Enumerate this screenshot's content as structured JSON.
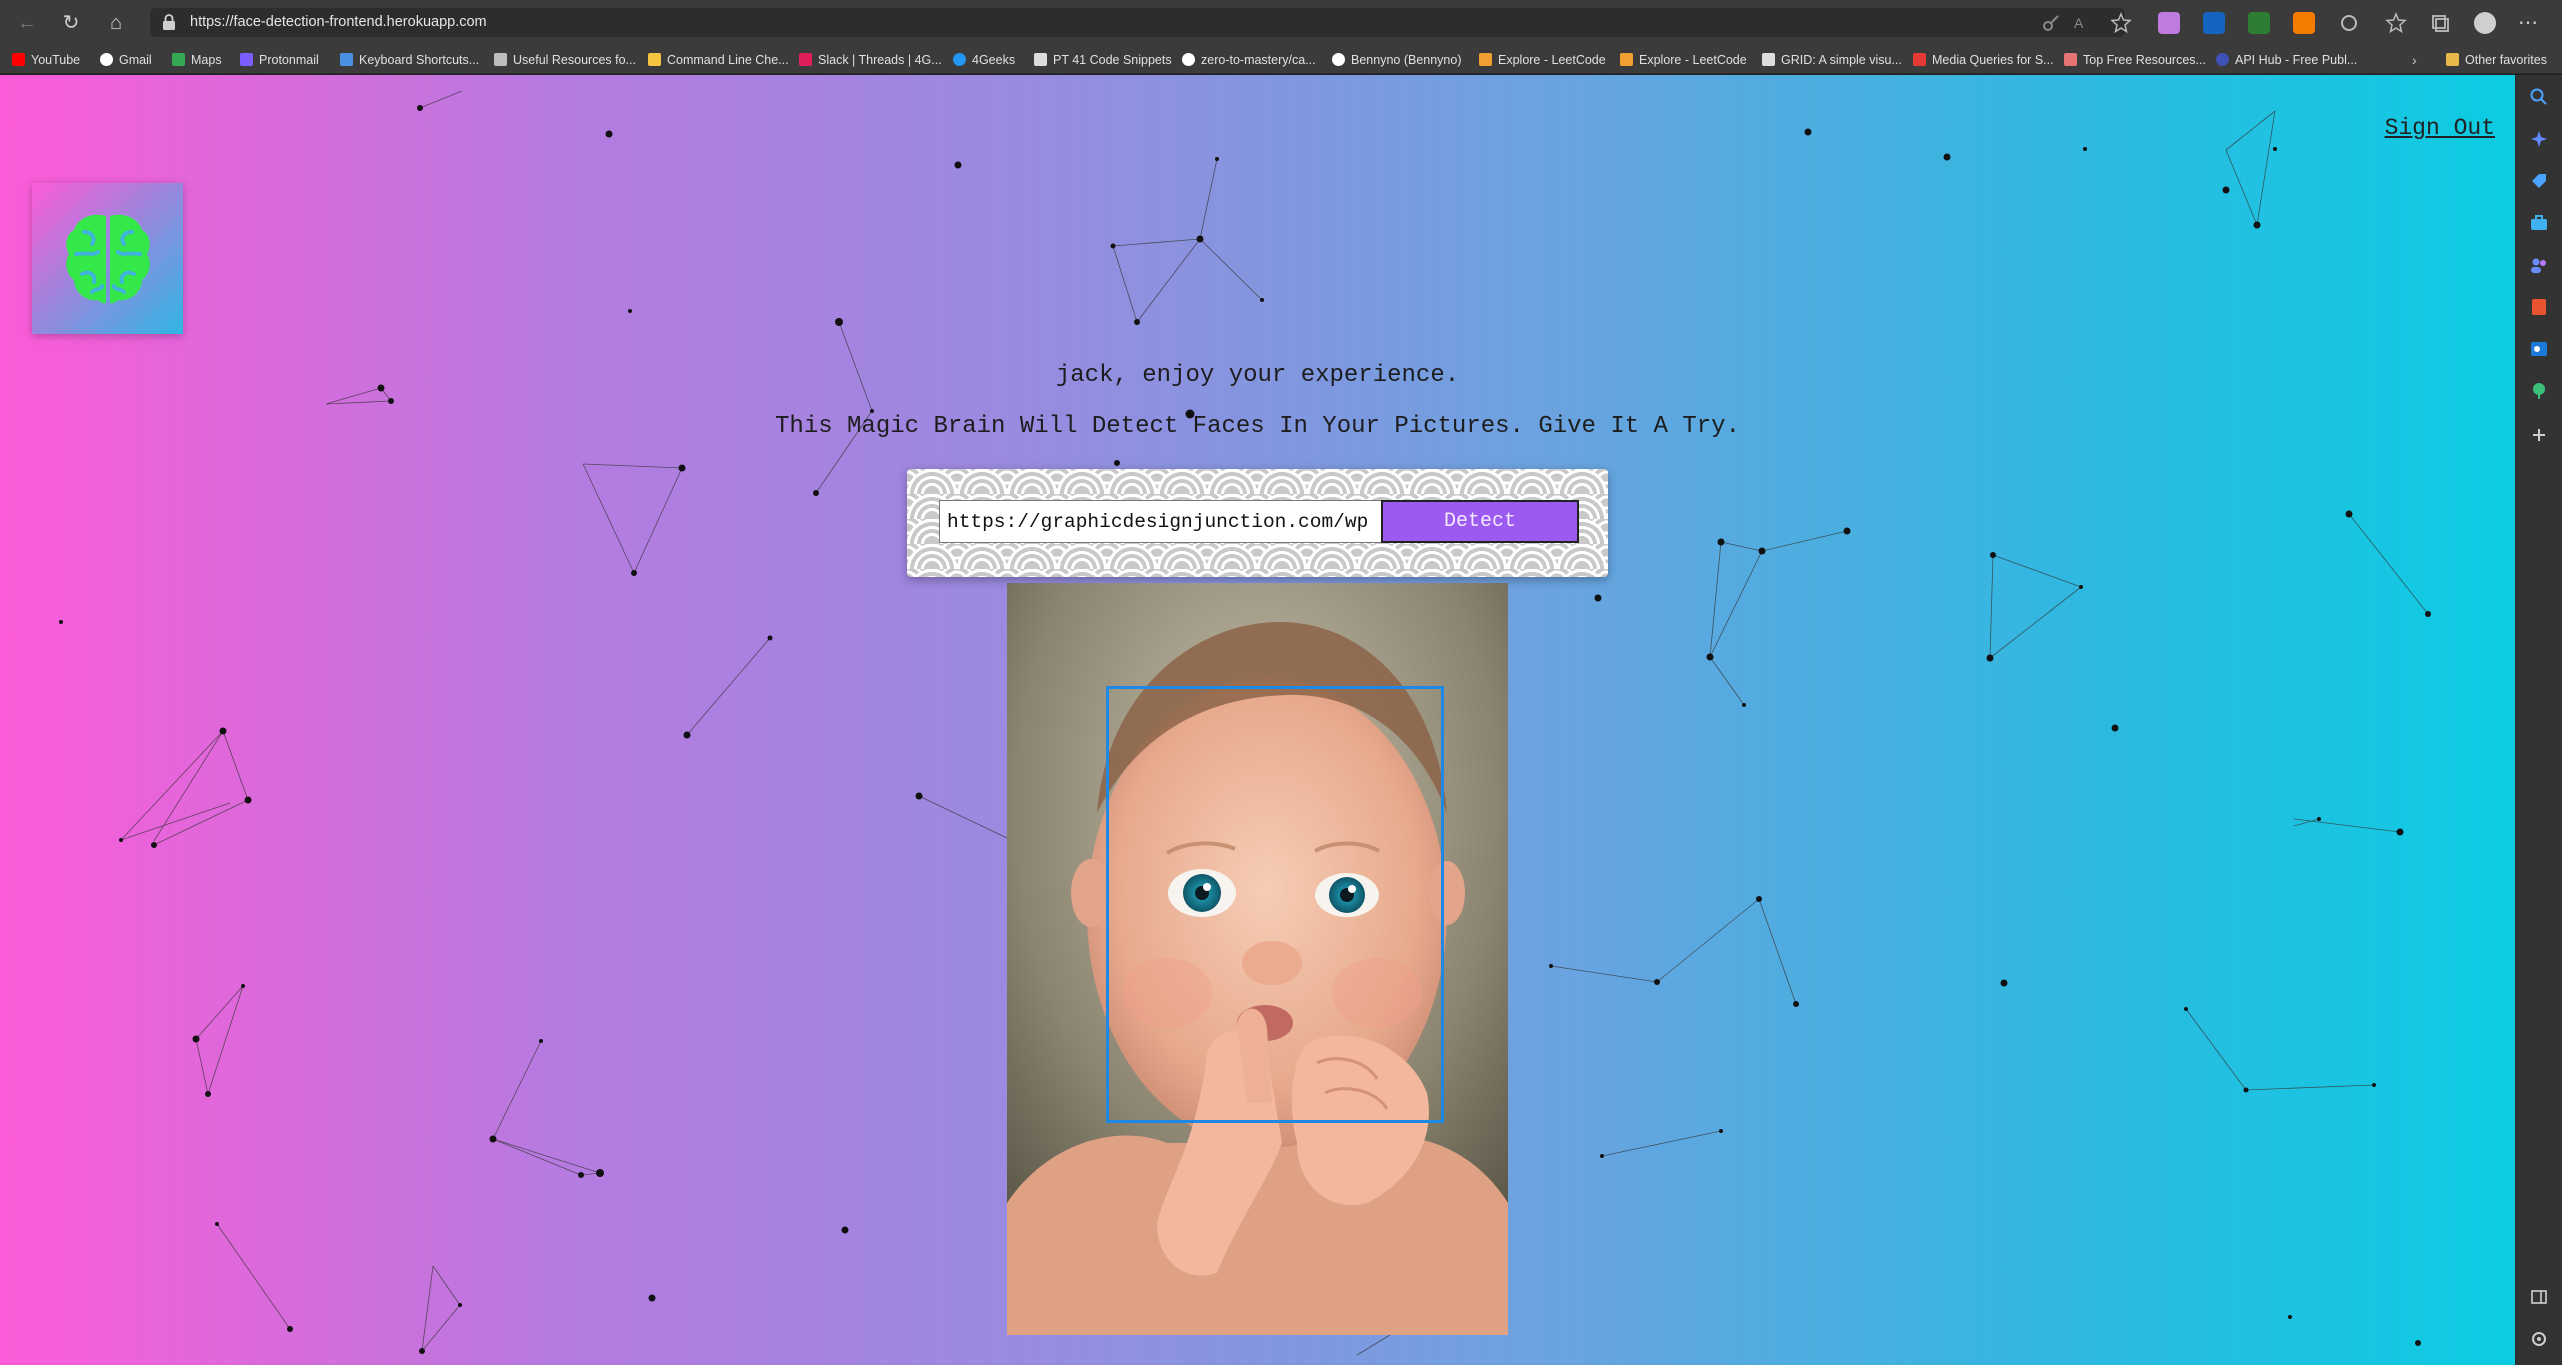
{
  "browser": {
    "url": "https://face-detection-frontend.herokuapp.com",
    "bookmarks": [
      {
        "label": "YouTube",
        "color": "#ff0000"
      },
      {
        "label": "Gmail",
        "color": "#ffffff"
      },
      {
        "label": "Maps",
        "color": "#34a853"
      },
      {
        "label": "Protonmail",
        "color": "#7b5cff"
      },
      {
        "label": "Keyboard Shortcuts...",
        "color": "#4a90e2"
      },
      {
        "label": "Useful Resources fo...",
        "color": "#bdbdbd"
      },
      {
        "label": "Command Line Che...",
        "color": "#f5c542"
      },
      {
        "label": "Slack | Threads | 4G...",
        "color": "#e01e5a"
      },
      {
        "label": "4Geeks",
        "color": "#2196f3"
      },
      {
        "label": "PT 41 Code Snippets",
        "color": "#dddddd"
      },
      {
        "label": "zero-to-mastery/ca...",
        "color": "#ffffff"
      },
      {
        "label": "Bennyno (Bennyno)",
        "color": "#ffffff"
      },
      {
        "label": "Explore - LeetCode",
        "color": "#f0a030"
      },
      {
        "label": "Explore - LeetCode",
        "color": "#f0a030"
      },
      {
        "label": "GRID: A simple visu...",
        "color": "#dddddd"
      },
      {
        "label": "Media Queries for S...",
        "color": "#e53935"
      },
      {
        "label": "Top Free Resources...",
        "color": "#e57373"
      },
      {
        "label": "API Hub - Free Publ...",
        "color": "#3f51b5"
      }
    ],
    "other_favorites": "Other favorites"
  },
  "app": {
    "sign_out": "Sign Out",
    "greeting": "jack, enjoy your experience.",
    "tagline": "This Magic Brain Will Detect Faces In Your Pictures. Give It A Try.",
    "image_url_input": "https://graphicdesignjunction.com/wp",
    "detect_label": "Detect"
  },
  "colors": {
    "gradient_start": "#fc5bd8",
    "gradient_end": "#0ccce2",
    "detect_button": "#9c5af0",
    "face_box": "#1e88e5",
    "brain_logo": "#35e84a"
  }
}
